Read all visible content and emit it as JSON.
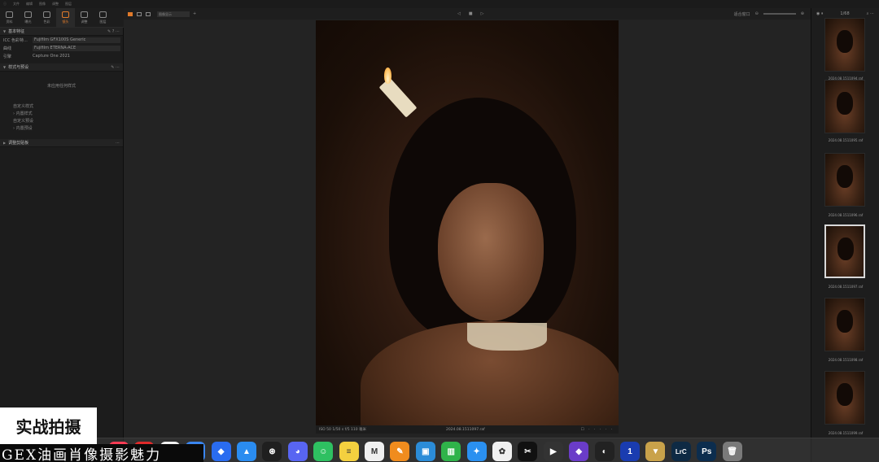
{
  "overlay": {
    "caption1": "实战拍摄",
    "caption2": "GEX油画肖像摄影魅力"
  },
  "menubar": {
    "items": [
      "ⓘ",
      "文件",
      "编辑",
      "图像",
      "调整",
      "图层"
    ],
    "title": "",
    "right": []
  },
  "toolbar": {
    "tools": [
      {
        "label": "资料",
        "icon": "library-icon"
      },
      {
        "label": "曝光",
        "icon": "exposure-icon"
      },
      {
        "label": "色彩",
        "icon": "color-icon"
      },
      {
        "label": "镜头",
        "icon": "lens-icon",
        "active": true
      },
      {
        "label": "调整",
        "icon": "adjust-icon"
      },
      {
        "label": "图层",
        "icon": "layers-icon"
      }
    ]
  },
  "panel_base": {
    "title": "基本特征",
    "rows": [
      {
        "key": "ICC 色彩特...",
        "value": "Fujifilm GFX100S Generic"
      },
      {
        "key": "曲线",
        "value": "Fujifilm ETERNA-ACE"
      },
      {
        "key": "引擎",
        "value": "Capture One 2021"
      }
    ]
  },
  "panel_styles": {
    "title": "样式与预设",
    "note": "未应用任何样式",
    "tree": [
      "自定义样式",
      "› 内置样式",
      "自定义预设",
      "› 内置预设"
    ]
  },
  "panel_adjust": {
    "title": "调整剪贴板"
  },
  "viewer": {
    "layout_select": "图像显示",
    "fit_label": "适合窗口",
    "meta": "ISO 50   1/50 s   f/5   110 毫米",
    "filename": "2024.08.1511097.raf",
    "stars": "☐ · · · · ·"
  },
  "filmstrip": {
    "count": "1/68",
    "thumbs": [
      {
        "caption": "2024.08.1511094.raf"
      },
      {
        "caption": "2024.08.1511095.raf"
      },
      {
        "caption": "2024.08.1511096.raf"
      },
      {
        "caption": "2024.08.1511097.raf",
        "selected": true
      },
      {
        "caption": "2024.08.1511098.raf"
      },
      {
        "caption": "2024.08.1511099.raf"
      }
    ]
  },
  "dock": {
    "apps": [
      {
        "name": "music",
        "glyph": "♫",
        "color": "#fa3c55"
      },
      {
        "name": "youdao",
        "glyph": "yd",
        "color": "#e02a2a"
      },
      {
        "name": "flash",
        "glyph": "⚡",
        "color": "#f2f2f2"
      },
      {
        "name": "baidu-netdisk",
        "glyph": "◎",
        "color": "#3a86f0"
      },
      {
        "name": "feishu",
        "glyph": "◆",
        "color": "#2a6cf0"
      },
      {
        "name": "lark-doc",
        "glyph": "▲",
        "color": "#2a8cf0"
      },
      {
        "name": "chatgpt",
        "glyph": "⊛",
        "color": "#1f1f1f"
      },
      {
        "name": "discord",
        "glyph": "◕",
        "color": "#5865f2"
      },
      {
        "name": "wechat",
        "glyph": "☺",
        "color": "#2ec061"
      },
      {
        "name": "notes",
        "glyph": "≡",
        "color": "#f4d03f"
      },
      {
        "name": "marginnote",
        "glyph": "M",
        "color": "#f0f0f0"
      },
      {
        "name": "pages",
        "glyph": "✎",
        "color": "#f08c1e"
      },
      {
        "name": "keynote",
        "glyph": "▣",
        "color": "#2b8cd8"
      },
      {
        "name": "numbers",
        "glyph": "▥",
        "color": "#2fb34a"
      },
      {
        "name": "safari",
        "glyph": "✦",
        "color": "#2a90f0"
      },
      {
        "name": "photos",
        "glyph": "✿",
        "color": "#f0f0f0"
      },
      {
        "name": "capcut",
        "glyph": "✂",
        "color": "#111111"
      },
      {
        "name": "final-cut",
        "glyph": "▶",
        "color": "#333333"
      },
      {
        "name": "shield",
        "glyph": "◆",
        "color": "#6a3cc8"
      },
      {
        "name": "capture-one",
        "glyph": "◐",
        "color": "#222222"
      },
      {
        "name": "1password",
        "glyph": "1",
        "color": "#1a3cb0"
      },
      {
        "name": "final-draft",
        "glyph": "▼",
        "color": "#c9a24a"
      },
      {
        "name": "lightroom",
        "glyph": "LrC",
        "color": "#0e2a44"
      },
      {
        "name": "photoshop",
        "glyph": "Ps",
        "color": "#0c2d4e"
      },
      {
        "name": "trash",
        "glyph": "🗑",
        "color": "#7a7a7a"
      }
    ]
  }
}
